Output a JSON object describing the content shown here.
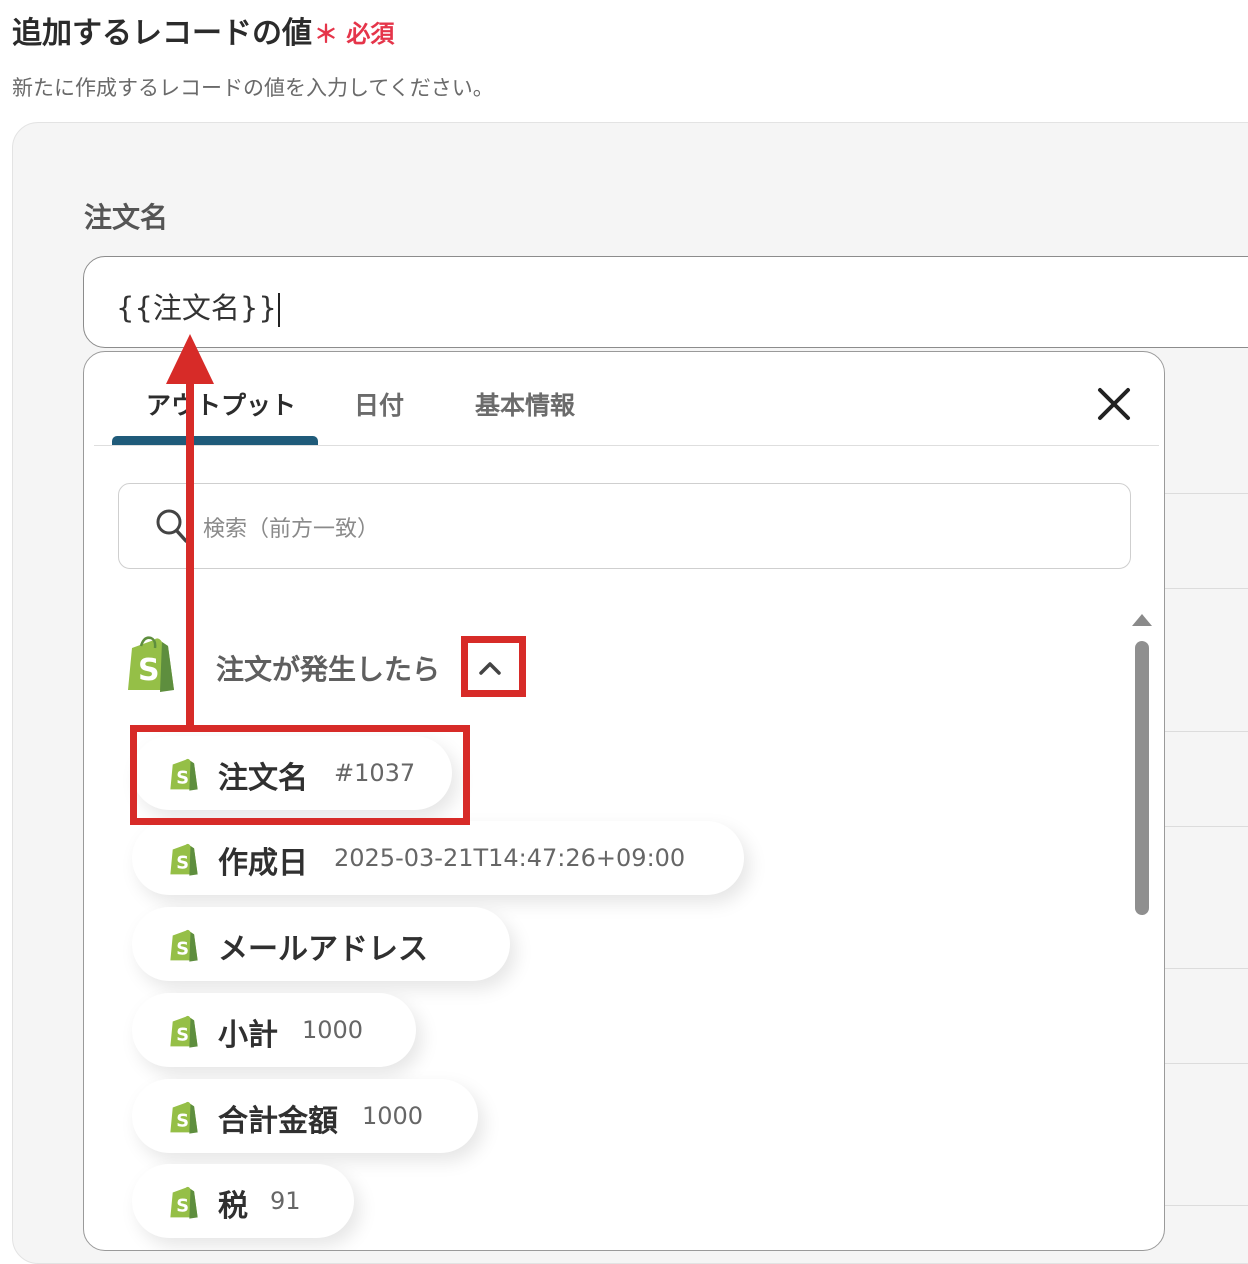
{
  "section": {
    "title": "追加するレコードの値",
    "required_badge": "＊ 必須",
    "description": "新たに作成するレコードの値を入力してください。"
  },
  "field": {
    "label": "注文名",
    "value": "{{注文名}}"
  },
  "popup": {
    "tabs": [
      {
        "label": "アウトプット",
        "active": true
      },
      {
        "label": "日付",
        "active": false
      },
      {
        "label": "基本情報",
        "active": false
      }
    ],
    "close_icon": "close-icon",
    "search_placeholder": "検索（前方一致）",
    "group": {
      "label": "注文が発生したら",
      "expanded": true,
      "items": [
        {
          "name": "注文名",
          "value": "#1037"
        },
        {
          "name": "作成日",
          "value": "2025-03-21T14:47:26+09:00"
        },
        {
          "name": "メールアドレス",
          "value": ""
        },
        {
          "name": "小計",
          "value": "1000"
        },
        {
          "name": "合計金額",
          "value": "1000"
        },
        {
          "name": "税",
          "value": "91"
        }
      ]
    }
  },
  "colors": {
    "accent_tab": "#1f5b7a",
    "required": "#e5354a",
    "annotation": "#d72b28",
    "shopify_green": "#95bf47",
    "shopify_dark": "#5e8e3e"
  }
}
